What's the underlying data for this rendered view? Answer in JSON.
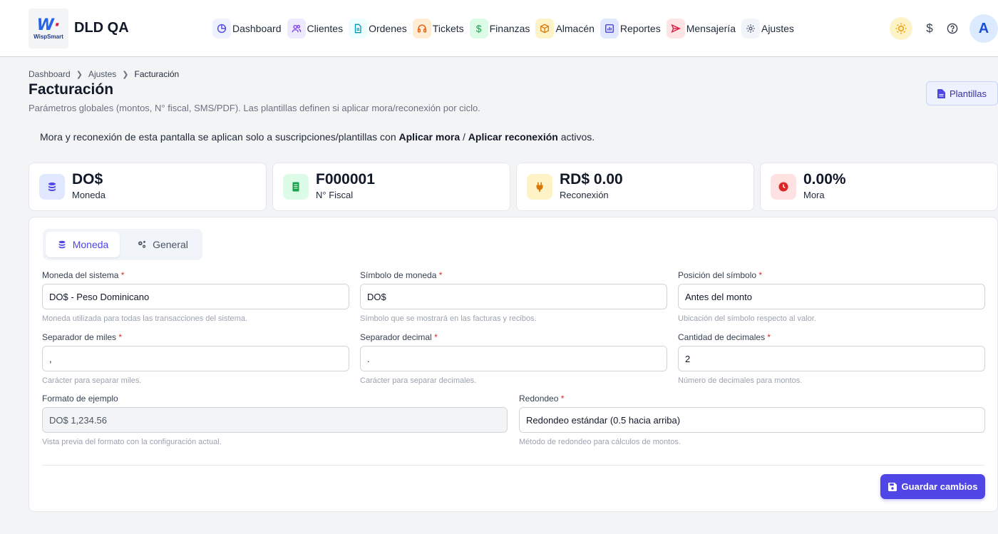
{
  "header": {
    "logo_text": "WispSmart",
    "app_title": "DLD QA",
    "nav": [
      {
        "label": "Dashboard",
        "icon": "chart-pie-icon",
        "bg": "#eef2ff",
        "color": "#4f46e5"
      },
      {
        "label": "Clientes",
        "icon": "users-icon",
        "bg": "#ede9fe",
        "color": "#7c3aed"
      },
      {
        "label": "Ordenes",
        "icon": "document-icon",
        "bg": "#ecfeff",
        "color": "#0891b2"
      },
      {
        "label": "Tickets",
        "icon": "headset-icon",
        "bg": "#ffedd5",
        "color": "#ea580c"
      },
      {
        "label": "Finanzas",
        "icon": "dollar-icon",
        "bg": "#dcfce7",
        "color": "#16a34a"
      },
      {
        "label": "Almacén",
        "icon": "box-icon",
        "bg": "#fef3c7",
        "color": "#d97706"
      },
      {
        "label": "Reportes",
        "icon": "report-icon",
        "bg": "#e0e7ff",
        "color": "#4338ca"
      },
      {
        "label": "Mensajería",
        "icon": "send-icon",
        "bg": "#ffe4e6",
        "color": "#e11d48"
      },
      {
        "label": "Ajustes",
        "icon": "gear-icon",
        "bg": "#f1f5f9",
        "color": "#475569"
      }
    ],
    "dollar_symbol": "$",
    "avatar_initial": "A"
  },
  "breadcrumb": [
    "Dashboard",
    "Ajustes",
    "Facturación"
  ],
  "page": {
    "title": "Facturación",
    "subtitle": "Parámetros globales (montos, N° fiscal, SMS/PDF). Las plantillas definen si aplicar mora/reconexión por ciclo.",
    "templates_button": "Plantillas"
  },
  "notice": {
    "prefix": "Mora y reconexión de esta pantalla se aplican solo a suscripciones/plantillas con ",
    "bold1": "Aplicar mora",
    "middle": " / ",
    "bold2": "Aplicar reconexión",
    "suffix": " activos."
  },
  "stats": [
    {
      "value": "DO$",
      "label": "Moneda",
      "icon": "coins-icon",
      "bg": "#e0e7ff",
      "color": "#4f46e5"
    },
    {
      "value": "F000001",
      "label": "N° Fiscal",
      "icon": "receipt-icon",
      "bg": "#dcfce7",
      "color": "#16a34a"
    },
    {
      "value": "RD$ 0.00",
      "label": "Reconexión",
      "icon": "plug-icon",
      "bg": "#fef3c7",
      "color": "#d97706"
    },
    {
      "value": "0.00%",
      "label": "Mora",
      "icon": "clock-icon",
      "bg": "#fee2e2",
      "color": "#dc2626"
    }
  ],
  "tabs": [
    {
      "label": "Moneda",
      "icon": "coins-icon"
    },
    {
      "label": "General",
      "icon": "gears-icon"
    }
  ],
  "form": {
    "currency": {
      "label": "Moneda del sistema",
      "value": "DO$ - Peso Dominicano",
      "hint": "Moneda utilizada para todas las transacciones del sistema."
    },
    "symbol": {
      "label": "Símbolo de moneda",
      "value": "DO$",
      "hint": "Símbolo que se mostrará en las facturas y recibos."
    },
    "symbol_position": {
      "label": "Posición del símbolo",
      "value": "Antes del monto",
      "hint": "Ubicación del símbolo respecto al valor."
    },
    "thousands_sep": {
      "label": "Separador de miles",
      "value": ",",
      "hint": "Carácter para separar miles."
    },
    "decimal_sep": {
      "label": "Separador decimal",
      "value": ".",
      "hint": "Carácter para separar decimales."
    },
    "decimals": {
      "label": "Cantidad de decimales",
      "value": "2",
      "hint": "Número de decimales para montos."
    },
    "example": {
      "label": "Formato de ejemplo",
      "value": "DO$ 1,234.56",
      "hint": "Vista previa del formato con la configuración actual."
    },
    "rounding": {
      "label": "Redondeo",
      "value": "Redondeo estándar (0.5 hacia arriba)",
      "hint": "Método de redondeo para cálculos de montos."
    },
    "required_mark": "*"
  },
  "save_button": "Guardar cambios"
}
